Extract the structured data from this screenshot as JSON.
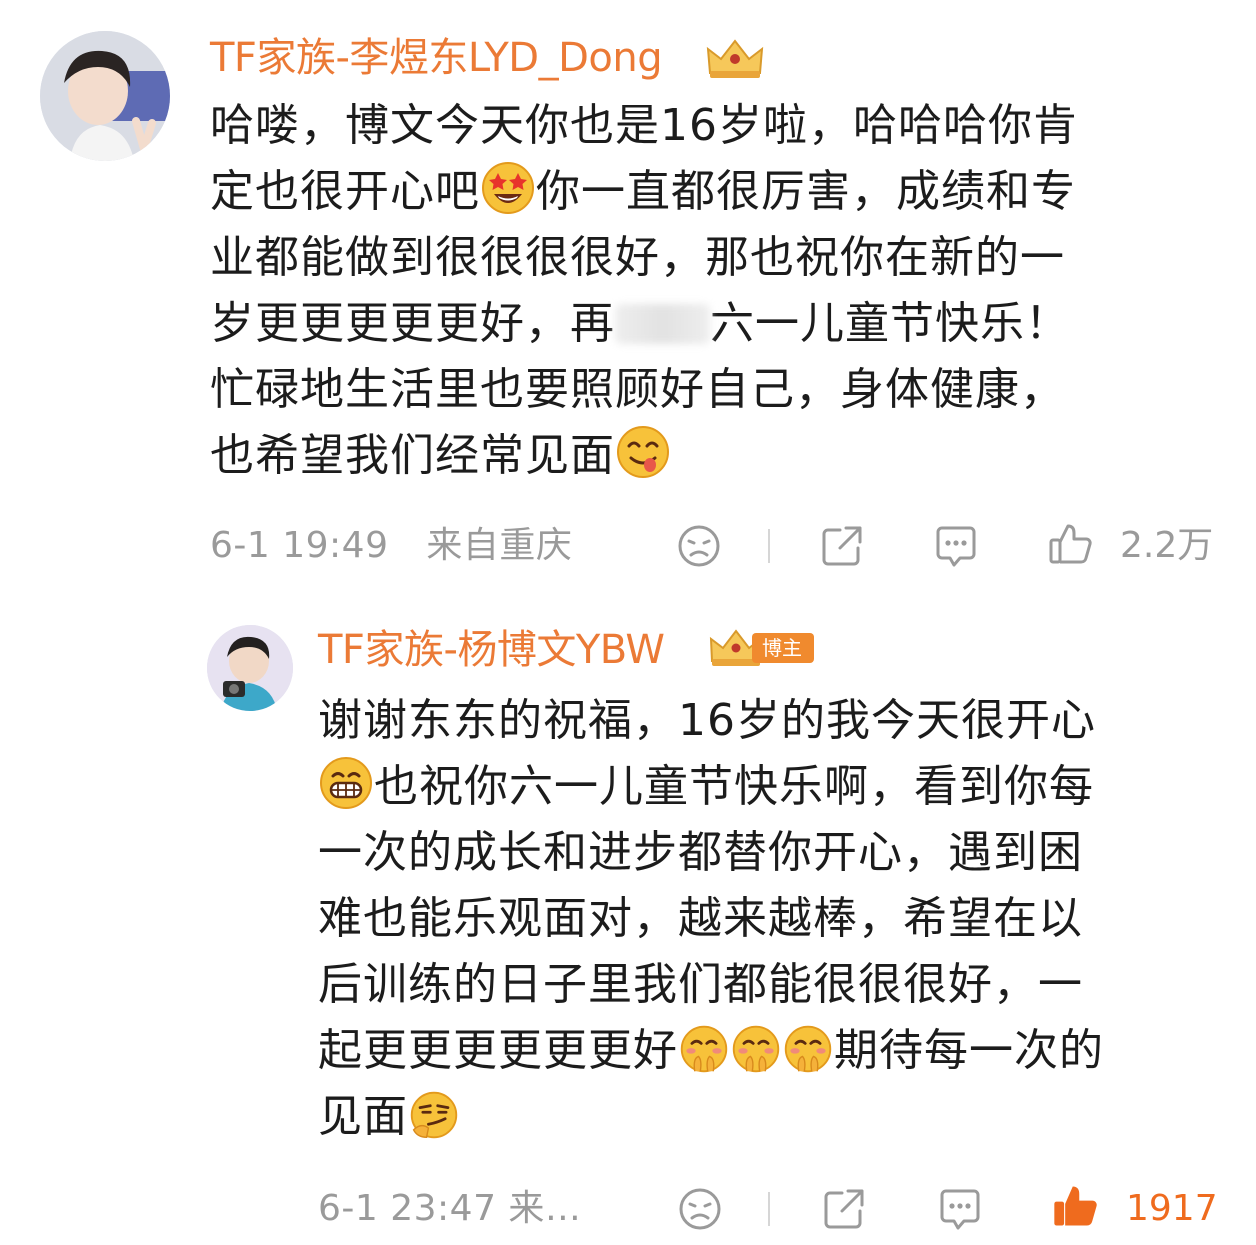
{
  "comments": [
    {
      "username": "TF家族-李煜东LYD_Dong",
      "lines": [
        "哈喽，博文今天你也是16岁啦，哈哈哈你肯",
        "定也很开心吧",
        "你一直都很厉害，成绩和专",
        "业都能做到很很很很好，那也祝你在新的一",
        "岁更更更更更好，再",
        "六一儿童节快乐！",
        "忙碌地生活里也要照顾好自己，身体健康，",
        "也希望我们经常见面"
      ],
      "time": "6-1 19:49",
      "location": "来自重庆",
      "likes": "2.2万"
    },
    {
      "username": "TF家族-杨博文YBW",
      "badge": "博主",
      "lines": [
        "谢谢东东的祝福，16岁的我今天很开心",
        "也祝你六一儿童节快乐啊，看到你每",
        "一次的成长和进步都替你开心，遇到困",
        "难也能乐观面对，越来越棒，希望在以",
        "后训练的日子里我们都能很很很好，一",
        "起更更更更更更好",
        "期待每一次的",
        "见面"
      ],
      "time_location": "6-1 23:47  来…",
      "likes": "1917"
    }
  ],
  "colors": {
    "username": "#eb7a36",
    "meta": "#9a9a9a",
    "like_active": "#ef6b1e"
  },
  "icons": [
    "dislike-face-icon",
    "share-icon",
    "comment-bubble-icon",
    "thumbs-up-icon",
    "crown-badge-icon"
  ]
}
